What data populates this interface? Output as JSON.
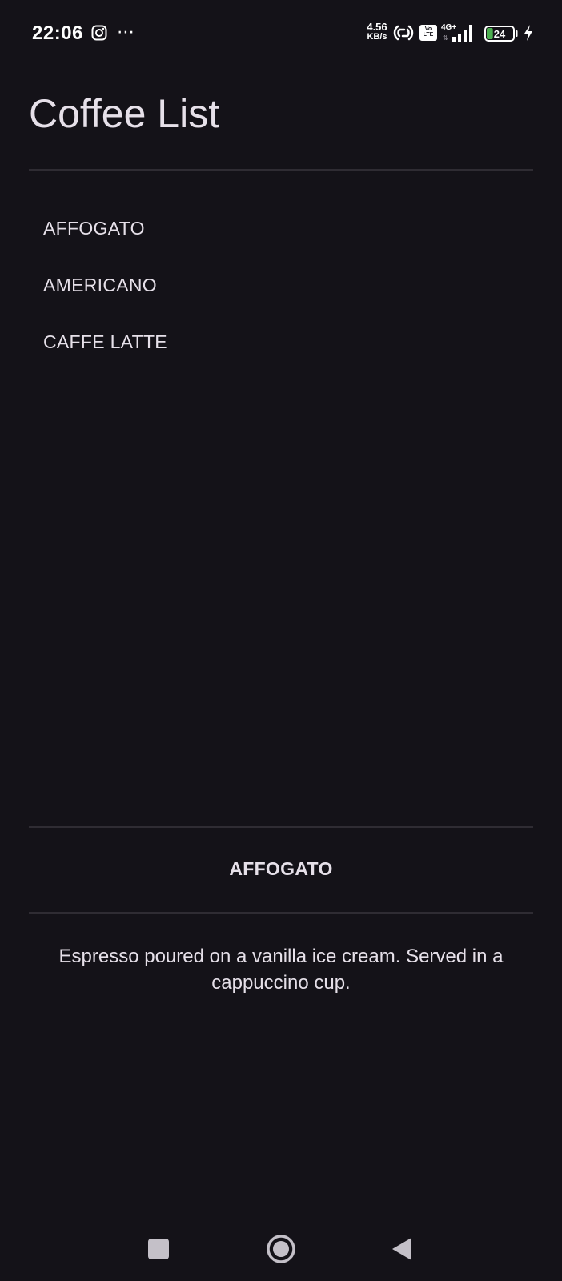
{
  "status_bar": {
    "time": "22:06",
    "net_speed_value": "4.56",
    "net_speed_unit": "KB/s",
    "network_type": "4G+",
    "volte_label_top": "Vo",
    "volte_label_bottom": "LTE",
    "battery_level": "24",
    "battery_fraction": 0.24,
    "battery_color": "#4caf50",
    "icons": [
      "instagram-icon",
      "more-icon",
      "hotspot-icon",
      "volte-icon",
      "signal-icon",
      "battery-icon",
      "charging-bolt-icon"
    ]
  },
  "header": {
    "title": "Coffee List"
  },
  "coffee_list": {
    "items": [
      {
        "label": "AFFOGATO"
      },
      {
        "label": "AMERICANO"
      },
      {
        "label": "CAFFE LATTE"
      }
    ]
  },
  "detail": {
    "title": "AFFOGATO",
    "description": "Espresso poured on a vanilla ice cream. Served in a cappuccino cup."
  },
  "navigation": {
    "icons": [
      "recents-icon",
      "home-icon",
      "back-icon"
    ]
  },
  "colors": {
    "background": "#141218",
    "text": "#e6e0e9",
    "divider": "#2f2c33"
  }
}
